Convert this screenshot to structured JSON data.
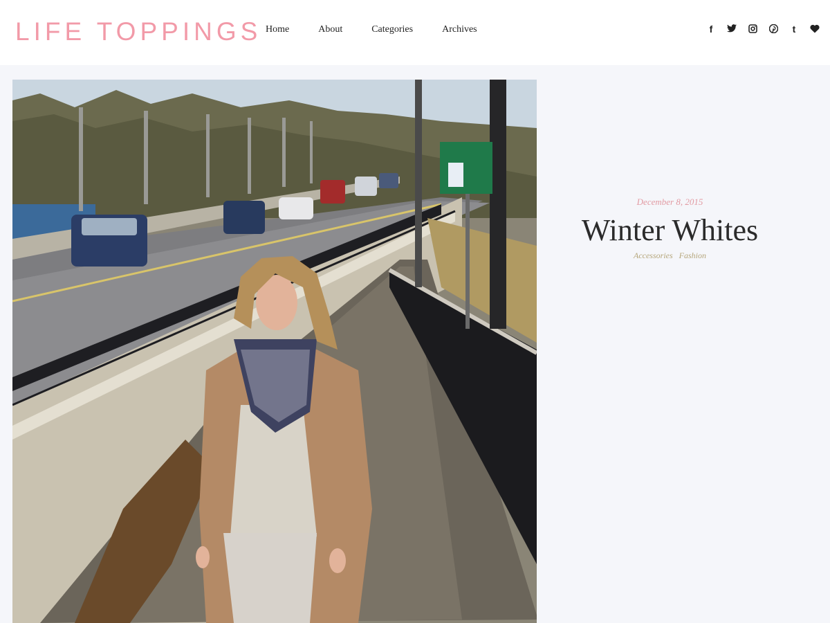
{
  "header": {
    "logo": "LIFE TOPPINGS",
    "nav": [
      "Home",
      "About",
      "Categories",
      "Archives"
    ],
    "social": [
      {
        "icon": "facebook-icon",
        "glyph": "f"
      },
      {
        "icon": "twitter-icon",
        "glyph": ""
      },
      {
        "icon": "instagram-icon",
        "glyph": ""
      },
      {
        "icon": "pinterest-icon",
        "glyph": ""
      },
      {
        "icon": "tumblr-icon",
        "glyph": "t"
      },
      {
        "icon": "heart-icon",
        "glyph": ""
      }
    ]
  },
  "post": {
    "date": "December 8, 2015",
    "title": "Winter Whites",
    "categories": [
      "Accessories",
      "Fashion"
    ]
  },
  "colors": {
    "logo": "#f29aa8",
    "date": "#e29aa2",
    "category": "#b5a67b",
    "background": "#f5f6fa"
  }
}
